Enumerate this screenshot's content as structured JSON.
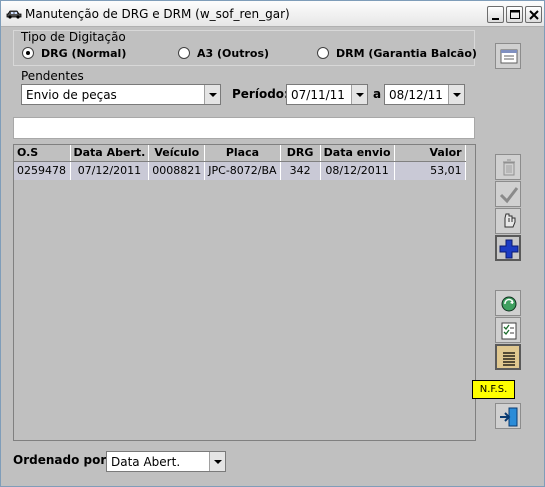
{
  "window": {
    "title": "Manutenção de DRG e DRM (w_sof_ren_gar)",
    "title_icon": "car-icon"
  },
  "digitacao": {
    "group_label": "Tipo de Digitação",
    "options": [
      {
        "label": "DRG (Normal)",
        "checked": true
      },
      {
        "label": "A3 (Outros)",
        "checked": false
      },
      {
        "label": "DRM (Garantia Balcão)",
        "checked": false
      }
    ]
  },
  "pendentes": {
    "label": "Pendentes",
    "value": "Envio de peças"
  },
  "periodo": {
    "label": "Período:",
    "from": "07/11/11",
    "separator": "a",
    "to": "08/12/11"
  },
  "filter": {
    "value": ""
  },
  "table": {
    "columns": [
      "O.S",
      "Data Abert.",
      "Veículo",
      "Placa",
      "DRG",
      "Data envio",
      "Valor"
    ],
    "rows": [
      [
        "0259478",
        "07/12/2011",
        "0008821",
        "JPC-8072/BA",
        "342",
        "08/12/2011",
        "53,01"
      ]
    ]
  },
  "sidebar": {
    "buttons": [
      {
        "icon": "list-icon",
        "enabled": true
      },
      {
        "icon": "trash-icon",
        "enabled": false
      },
      {
        "icon": "checkmark-icon",
        "enabled": false
      },
      {
        "icon": "hand-pointer-icon",
        "enabled": true
      },
      {
        "icon": "plus-icon",
        "enabled": true
      },
      {
        "icon": "refresh-icon",
        "enabled": true
      },
      {
        "icon": "checklist-icon",
        "enabled": true
      },
      {
        "icon": "text-lines-icon",
        "enabled": true
      },
      {
        "icon": "exit-door-icon",
        "enabled": true
      }
    ],
    "tooltip": "N.F.S."
  },
  "ordenado": {
    "label": "Ordenado por :",
    "value": "Data Abert."
  },
  "colors": {
    "window_bg": "#c0c0c0",
    "row_highlight": "#c9c9d6",
    "tooltip_bg": "#ffff00",
    "accent_blue": "#1c3cc4"
  }
}
